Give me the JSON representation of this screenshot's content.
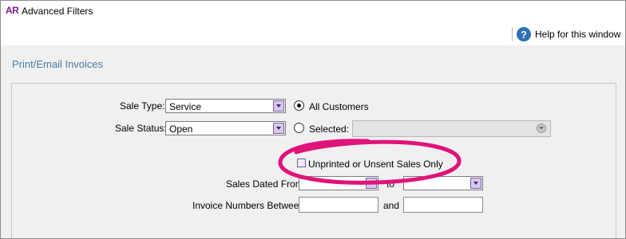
{
  "window": {
    "app_badge": "AR",
    "title": "Advanced Filters",
    "help_label": "Help for this window"
  },
  "section_title": "Print/Email Invoices",
  "form": {
    "sale_type_label": "Sale Type:",
    "sale_type_value": "Service",
    "sale_status_label": "Sale Status:",
    "sale_status_value": "Open",
    "all_customers_label": "All Customers",
    "all_customers_selected": true,
    "selected_label": "Selected:",
    "unprinted_label": "Unprinted or Unsent Sales Only",
    "unprinted_checked": false,
    "sales_dated_from_label": "Sales Dated From",
    "to_label": "to",
    "sales_dated_from_value": "",
    "sales_dated_to_value": "",
    "invoice_numbers_label": "Invoice Numbers Between",
    "and_label": "and",
    "invoice_from_value": "",
    "invoice_to_value": ""
  },
  "colors": {
    "highlight": "#e0137a",
    "section_title": "#4a7aa8",
    "help_icon": "#2f6fb5"
  },
  "icons": {
    "help": "question-circle-icon",
    "dropdown": "chevron-down-icon"
  }
}
